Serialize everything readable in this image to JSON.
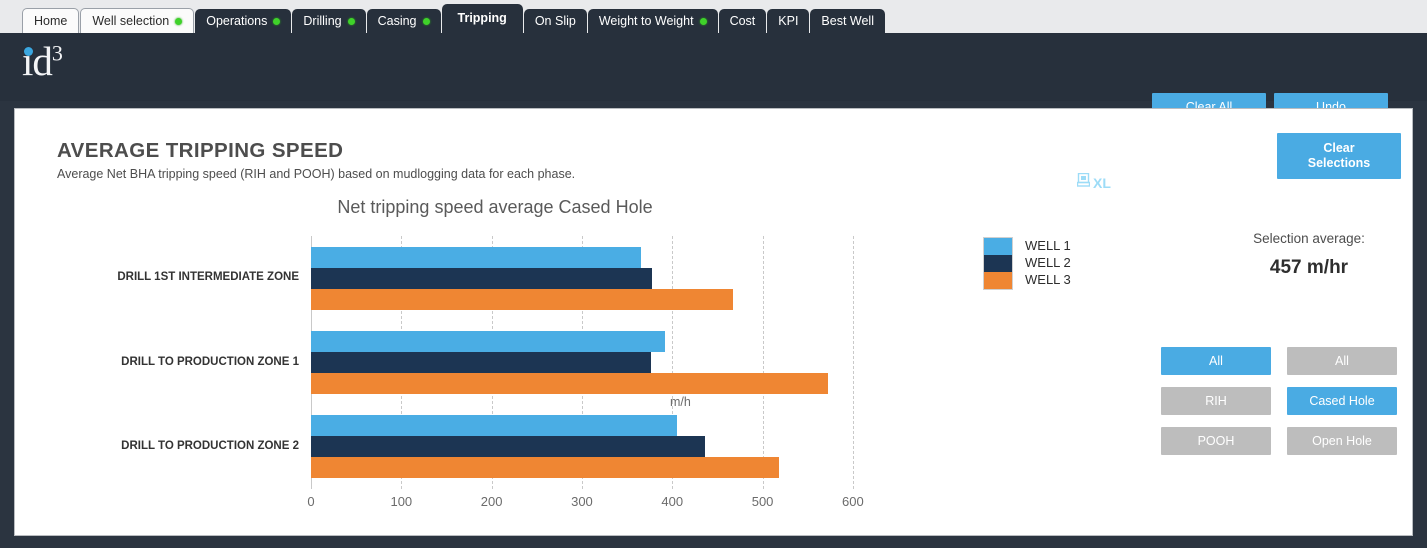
{
  "tabs": [
    {
      "label": "Home",
      "style": "light",
      "dot": false,
      "active": false
    },
    {
      "label": "Well selection",
      "style": "light",
      "dot": true,
      "active": false
    },
    {
      "label": "Operations",
      "style": "dark",
      "dot": true,
      "active": false
    },
    {
      "label": "Drilling",
      "style": "dark",
      "dot": true,
      "active": false
    },
    {
      "label": "Casing",
      "style": "dark",
      "dot": true,
      "active": false
    },
    {
      "label": "Tripping",
      "style": "dark",
      "dot": false,
      "active": true
    },
    {
      "label": "On Slip",
      "style": "dark",
      "dot": false,
      "active": false
    },
    {
      "label": "Weight to Weight",
      "style": "dark",
      "dot": true,
      "active": false
    },
    {
      "label": "Cost",
      "style": "dark",
      "dot": false,
      "active": false
    },
    {
      "label": "KPI",
      "style": "dark",
      "dot": false,
      "active": false
    },
    {
      "label": "Best Well",
      "style": "dark",
      "dot": false,
      "active": false
    }
  ],
  "header": {
    "logo_text": "id",
    "logo_superscript": "3",
    "clear_all_label": "Clear All",
    "undo_label": "Undo"
  },
  "page": {
    "title": "AVERAGE TRIPPING SPEED",
    "subtitle": "Average Net BHA tripping speed (RIH and POOH) based on mudlogging data for each phase.",
    "export_icon": "export-grid-icon",
    "export_label": "XL",
    "clear_selections_line1": "Clear",
    "clear_selections_line2": "Selections"
  },
  "summary": {
    "label": "Selection average:",
    "value": "457 m/hr"
  },
  "filters": {
    "left_column": [
      {
        "label": "All",
        "active": true
      },
      {
        "label": "RIH",
        "active": false
      },
      {
        "label": "POOH",
        "active": false
      }
    ],
    "right_column": [
      {
        "label": "All",
        "active": false
      },
      {
        "label": "Cased Hole",
        "active": true
      },
      {
        "label": "Open Hole",
        "active": false
      }
    ]
  },
  "colors": {
    "accent_blue": "#4aabe3",
    "well1": "#4aade4",
    "well2": "#1c3553",
    "well3": "#ef8633",
    "inactive_gray": "#bdbdbd",
    "header_dark": "#27303c",
    "status_dot_green": "#3fd22a"
  },
  "chart_data": {
    "type": "bar",
    "orientation": "horizontal",
    "title": "Net tripping speed average Cased Hole",
    "xlabel": "m/h",
    "ylabel": "",
    "xlim": [
      0,
      640
    ],
    "xticks": [
      0,
      100,
      200,
      300,
      400,
      500,
      600
    ],
    "grid": true,
    "legend_position": "right",
    "categories": [
      "DRILL 1ST INTERMEDIATE ZONE",
      "DRILL TO PRODUCTION ZONE 1",
      "DRILL TO PRODUCTION ZONE 2"
    ],
    "series": [
      {
        "name": "WELL 1",
        "color": "#4aade4",
        "values": [
          365,
          392,
          405
        ]
      },
      {
        "name": "WELL 2",
        "color": "#1c3553",
        "values": [
          378,
          376,
          436
        ]
      },
      {
        "name": "WELL 3",
        "color": "#ef8633",
        "values": [
          467,
          573,
          518
        ]
      }
    ]
  }
}
